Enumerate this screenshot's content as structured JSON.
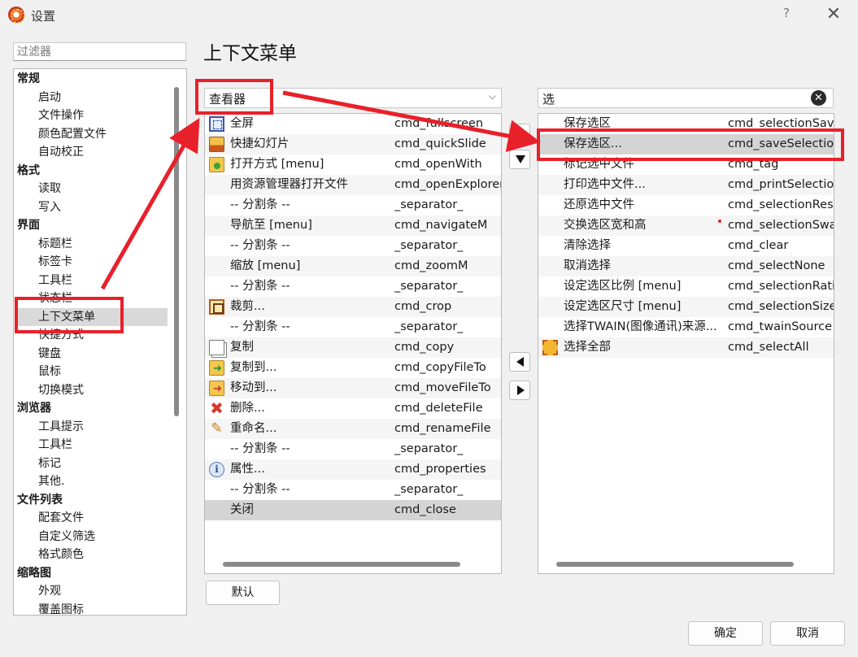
{
  "window": {
    "title": "设置",
    "help_label": "?",
    "close_label": "✕"
  },
  "filter": {
    "placeholder": "过滤器"
  },
  "tree": {
    "items": [
      {
        "label": "常规",
        "kind": "group"
      },
      {
        "label": "启动",
        "kind": "item"
      },
      {
        "label": "文件操作",
        "kind": "item"
      },
      {
        "label": "颜色配置文件",
        "kind": "item"
      },
      {
        "label": "自动校正",
        "kind": "item"
      },
      {
        "label": "格式",
        "kind": "group"
      },
      {
        "label": "读取",
        "kind": "item"
      },
      {
        "label": "写入",
        "kind": "item"
      },
      {
        "label": "界面",
        "kind": "group"
      },
      {
        "label": "标题栏",
        "kind": "item"
      },
      {
        "label": "标签卡",
        "kind": "item"
      },
      {
        "label": "工具栏",
        "kind": "item"
      },
      {
        "label": "状态栏",
        "kind": "item"
      },
      {
        "label": "上下文菜单",
        "kind": "item",
        "selected": true
      },
      {
        "label": "快捷方式",
        "kind": "item"
      },
      {
        "label": "键盘",
        "kind": "item"
      },
      {
        "label": "鼠标",
        "kind": "item"
      },
      {
        "label": "切换模式",
        "kind": "item"
      },
      {
        "label": "浏览器",
        "kind": "group"
      },
      {
        "label": "工具提示",
        "kind": "item"
      },
      {
        "label": "工具栏",
        "kind": "item"
      },
      {
        "label": "标记",
        "kind": "item"
      },
      {
        "label": "其他.",
        "kind": "item"
      },
      {
        "label": "文件列表",
        "kind": "group"
      },
      {
        "label": "配套文件",
        "kind": "item"
      },
      {
        "label": "自定义筛选",
        "kind": "item"
      },
      {
        "label": "格式颜色",
        "kind": "item"
      },
      {
        "label": "缩略图",
        "kind": "group"
      },
      {
        "label": "外观",
        "kind": "item"
      },
      {
        "label": "覆盖图标",
        "kind": "item"
      }
    ]
  },
  "page": {
    "title": "上下文菜单"
  },
  "context_select": {
    "value": "查看器",
    "arrow": "⌵"
  },
  "right_search": {
    "value": "选"
  },
  "left_list": {
    "rows": [
      {
        "name": "全屏",
        "cmd": "cmd_fullscreen",
        "icon": "fullscreen-icon"
      },
      {
        "name": "快捷幻灯片",
        "cmd": "cmd_quickSlide",
        "icon": "slideshow-icon"
      },
      {
        "name": "打开方式 [menu]",
        "cmd": "cmd_openWith",
        "icon": "open-with-icon"
      },
      {
        "name": "用资源管理器打开文件",
        "cmd": "cmd_openExplorer",
        "icon": ""
      },
      {
        "name": "-- 分割条 --",
        "cmd": "_separator_",
        "icon": ""
      },
      {
        "name": "导航至 [menu]",
        "cmd": "cmd_navigateM",
        "icon": ""
      },
      {
        "name": "-- 分割条 --",
        "cmd": "_separator_",
        "icon": ""
      },
      {
        "name": "缩放 [menu]",
        "cmd": "cmd_zoomM",
        "icon": ""
      },
      {
        "name": "-- 分割条 --",
        "cmd": "_separator_",
        "icon": ""
      },
      {
        "name": "裁剪...",
        "cmd": "cmd_crop",
        "icon": "crop-icon"
      },
      {
        "name": "-- 分割条 --",
        "cmd": "_separator_",
        "icon": ""
      },
      {
        "name": "复制",
        "cmd": "cmd_copy",
        "icon": "copy-icon"
      },
      {
        "name": "复制到...",
        "cmd": "cmd_copyFileTo",
        "icon": "copy-to-icon"
      },
      {
        "name": "移动到...",
        "cmd": "cmd_moveFileTo",
        "icon": "move-to-icon"
      },
      {
        "name": "删除...",
        "cmd": "cmd_deleteFile",
        "icon": "delete-icon"
      },
      {
        "name": "重命名...",
        "cmd": "cmd_renameFile",
        "icon": "rename-icon"
      },
      {
        "name": "-- 分割条 --",
        "cmd": "_separator_",
        "icon": ""
      },
      {
        "name": "属性...",
        "cmd": "cmd_properties",
        "icon": "properties-icon"
      },
      {
        "name": "-- 分割条 --",
        "cmd": "_separator_",
        "icon": ""
      },
      {
        "name": "关闭",
        "cmd": "cmd_close",
        "icon": "",
        "selected": true
      }
    ]
  },
  "right_list": {
    "rows": [
      {
        "name": "保存选区",
        "cmd": "cmd_selectionSave",
        "icon": ""
      },
      {
        "name": "保存选区...",
        "cmd": "cmd_saveSelection",
        "icon": "",
        "selected": true
      },
      {
        "name": "标记选中文件",
        "cmd": "cmd_tag",
        "icon": ""
      },
      {
        "name": "打印选中文件...",
        "cmd": "cmd_printSelection",
        "icon": ""
      },
      {
        "name": "还原选中文件",
        "cmd": "cmd_selectionRest",
        "icon": ""
      },
      {
        "name": "交换选区宽和高",
        "cmd": "cmd_selectionSwa",
        "icon": ""
      },
      {
        "name": "清除选择",
        "cmd": "cmd_clear",
        "icon": ""
      },
      {
        "name": "取消选择",
        "cmd": "cmd_selectNone",
        "icon": ""
      },
      {
        "name": "设定选区比例 [menu]",
        "cmd": "cmd_selectionRatio",
        "icon": ""
      },
      {
        "name": "设定选区尺寸 [menu]",
        "cmd": "cmd_selectionSize",
        "icon": ""
      },
      {
        "name": "选择TWAIN(图像通讯)来源...",
        "cmd": "cmd_twainSource",
        "icon": ""
      },
      {
        "name": "选择全部",
        "cmd": "cmd_selectAll",
        "icon": "select-all-icon"
      }
    ]
  },
  "buttons": {
    "default_label": "默认",
    "ok_label": "确定",
    "cancel_label": "取消"
  },
  "colors": {
    "annotation_red": "#e8202a",
    "selection": "#d4d4d4"
  }
}
